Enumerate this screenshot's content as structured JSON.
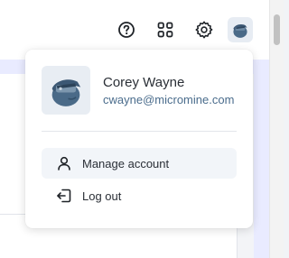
{
  "header": {
    "icons": [
      {
        "name": "help-icon"
      },
      {
        "name": "apps-grid-icon"
      },
      {
        "name": "settings-icon"
      },
      {
        "name": "user-avatar"
      }
    ]
  },
  "account_menu": {
    "user": {
      "name": "Corey Wayne",
      "email": "cwayne@micromine.com",
      "avatar": "user-avatar-icon"
    },
    "items": [
      {
        "label": "Manage account",
        "icon": "user-icon",
        "active": true
      },
      {
        "label": "Log out",
        "icon": "logout-icon",
        "active": false
      }
    ]
  },
  "colors": {
    "accent_band": "#e9ebff",
    "email_text": "#4a6c8c",
    "avatar_bg": "#e8edf3",
    "avatar_figure": "#4a6a88"
  }
}
